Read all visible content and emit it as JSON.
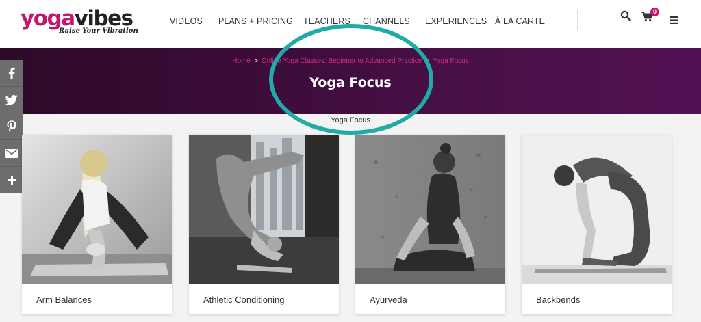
{
  "logo": {
    "part1": "yoga",
    "part2": "vibes",
    "tagline": "Raise Your Vibration"
  },
  "nav": [
    {
      "label": "VIDEOS"
    },
    {
      "label": "PLANS + PRICING"
    },
    {
      "label": "TEACHERS"
    },
    {
      "label": "CHANNELS"
    },
    {
      "label": "EXPERIENCES"
    },
    {
      "label": "À LA CARTE"
    }
  ],
  "header_icons": {
    "search": "search-icon",
    "cart": "cart-icon",
    "menu": "hamburger-icon",
    "cart_count": "0"
  },
  "breadcrumb": {
    "items": [
      "Home",
      "Online Yoga Classes: Beginner to Advanced Practice",
      "Yoga Focus"
    ],
    "separator": ">"
  },
  "page": {
    "title": "Yoga Focus",
    "subtitle": "Yoga Focus"
  },
  "share": [
    "facebook-icon",
    "twitter-icon",
    "pinterest-icon",
    "email-icon",
    "plus-icon"
  ],
  "cards": [
    {
      "label": "Arm Balances"
    },
    {
      "label": "Athletic Conditioning"
    },
    {
      "label": "Ayurveda"
    },
    {
      "label": "Backbends"
    }
  ],
  "colors": {
    "brand": "#c4166c",
    "hero": "#471046",
    "annotation": "#20aaa8",
    "share_bg": "#6d6d6d"
  }
}
